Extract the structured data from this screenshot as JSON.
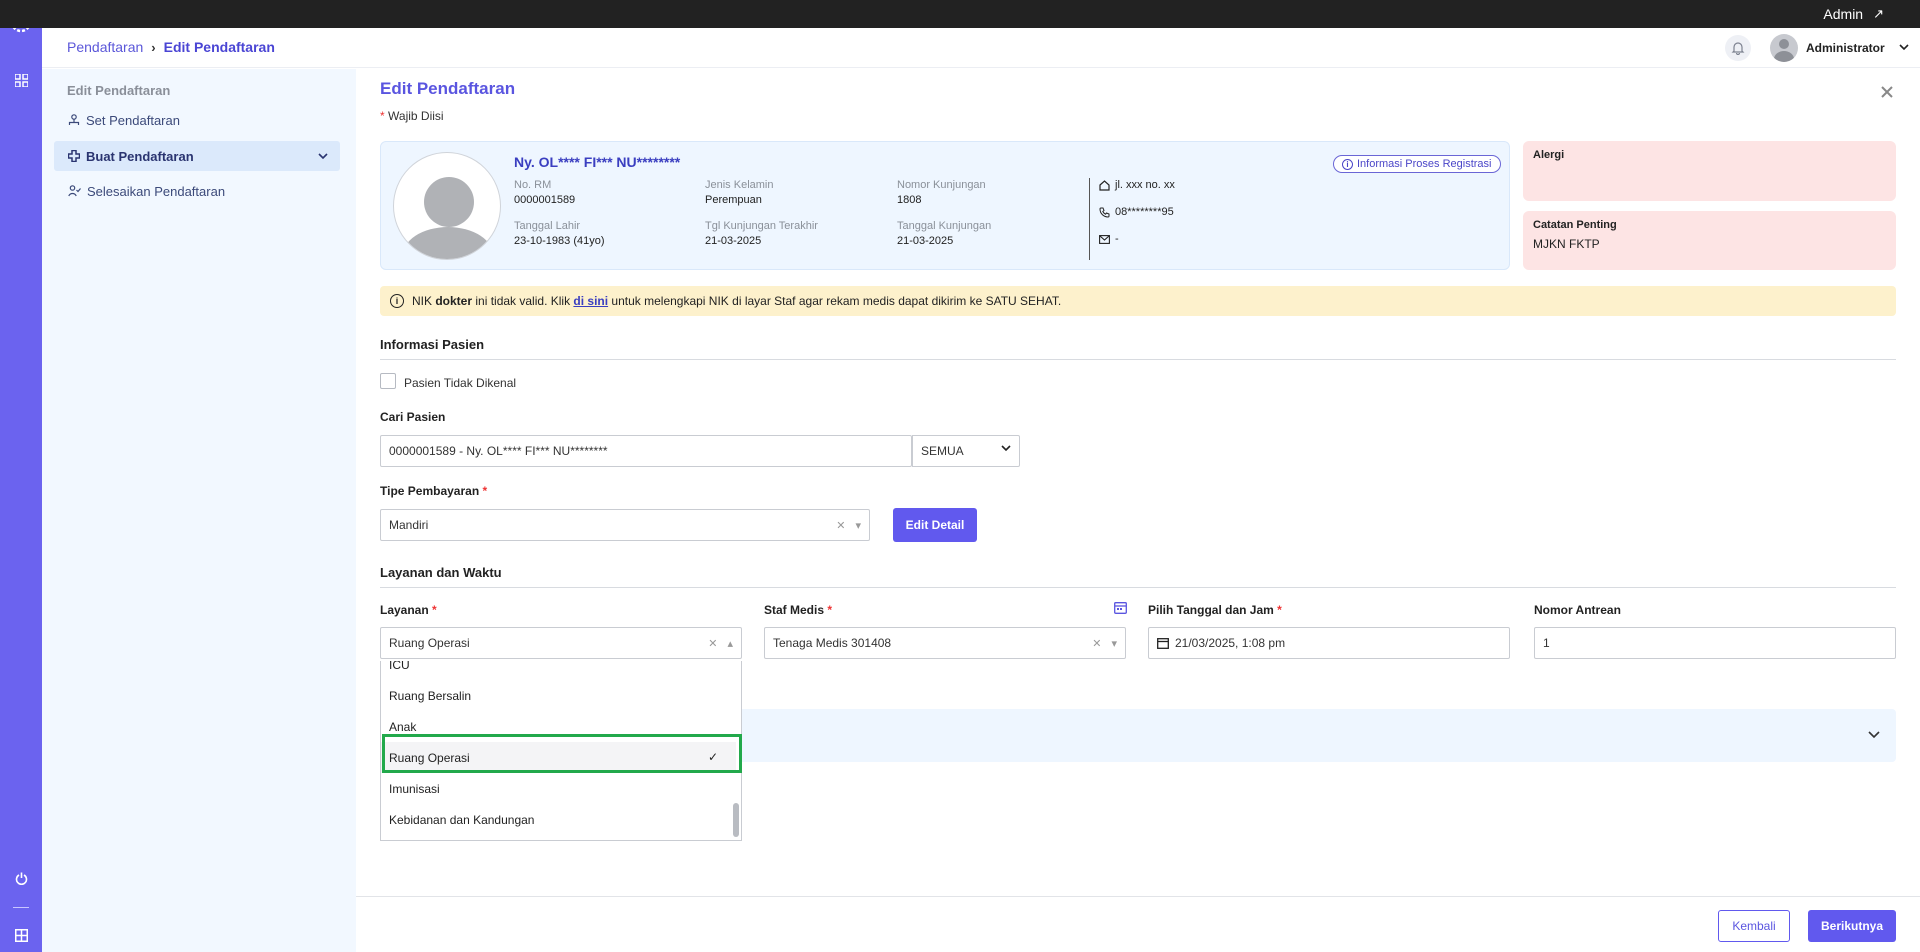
{
  "topbar": {
    "user_label": "Admin",
    "arrow": "↗"
  },
  "header": {
    "breadcrumb": [
      "Pendaftaran",
      "Edit Pendaftaran"
    ],
    "separator": "›",
    "user_name": "Administrator"
  },
  "sidebar": {
    "title": "Edit Pendaftaran",
    "items": [
      {
        "label": "Set Pendaftaran",
        "icon": "user-group-icon"
      },
      {
        "label": "Buat Pendaftaran",
        "icon": "plus-cross-icon"
      },
      {
        "label": "Selesaikan Pendaftaran",
        "icon": "user-check-icon"
      }
    ]
  },
  "page": {
    "title": "Edit Pendaftaran",
    "required_star": "*",
    "required_note": "Wajib Diisi"
  },
  "patient": {
    "name": "Ny. OL**** FI*** NU********",
    "info_button": "Informasi Proses Registrasi",
    "fields": {
      "no_rm_label": "No. RM",
      "no_rm": "0000001589",
      "gender_label": "Jenis Kelamin",
      "gender": "Perempuan",
      "visit_no_label": "Nomor Kunjungan",
      "visit_no": "1808",
      "dob_label": "Tanggal Lahir",
      "dob": "23-10-1983 (41yo)",
      "last_visit_label": "Tgl Kunjungan Terakhir",
      "last_visit": "21-03-2025",
      "visit_date_label": "Tanggal Kunjungan",
      "visit_date": "21-03-2025"
    },
    "address": "jl. xxx no. xx",
    "phone": "08********95",
    "email": "-"
  },
  "alergi": {
    "title": "Alergi",
    "value": ""
  },
  "catatan": {
    "title": "Catatan Penting",
    "value": "MJKN FKTP"
  },
  "warning": {
    "t1": "NIK ",
    "bold": "dokter",
    "t2": " ini tidak valid. Klik ",
    "link": "di sini",
    "t3": " untuk melengkapi NIK di layar Staf agar rekam medis dapat dikirim ke SATU SEHAT."
  },
  "sections": {
    "patient_info": "Informasi Pasien",
    "service_time": "Layanan dan Waktu"
  },
  "form": {
    "unknown_patient": "Pasien Tidak Dikenal",
    "search_label": "Cari Pasien",
    "search_value": "0000001589 - Ny. OL**** FI*** NU********",
    "search_filter": "SEMUA",
    "payment_label": "Tipe Pembayaran",
    "payment_value": "Mandiri",
    "edit_detail": "Edit Detail",
    "service_label": "Layanan",
    "service_value": "Ruang Operasi",
    "staff_label": "Staf Medis",
    "staff_value": "Tenaga Medis 301408",
    "datetime_label": "Pilih Tanggal dan Jam",
    "datetime_value": "21/03/2025, 1:08 pm",
    "queue_label": "Nomor Antrean",
    "queue_value": "1",
    "star": "*"
  },
  "dropdown": {
    "options": [
      "ICU",
      "Ruang Bersalin",
      "Anak",
      "Ruang Operasi",
      "Imunisasi",
      "Kebidanan dan Kandungan"
    ],
    "selected": "Ruang Operasi",
    "check": "✓"
  },
  "footer": {
    "back": "Kembali",
    "next": "Berikutnya"
  },
  "colors": {
    "primary": "#6159ee",
    "rail": "#6b63ef",
    "warning_bg": "#fdf1cc",
    "highlight": "#22a94b"
  }
}
